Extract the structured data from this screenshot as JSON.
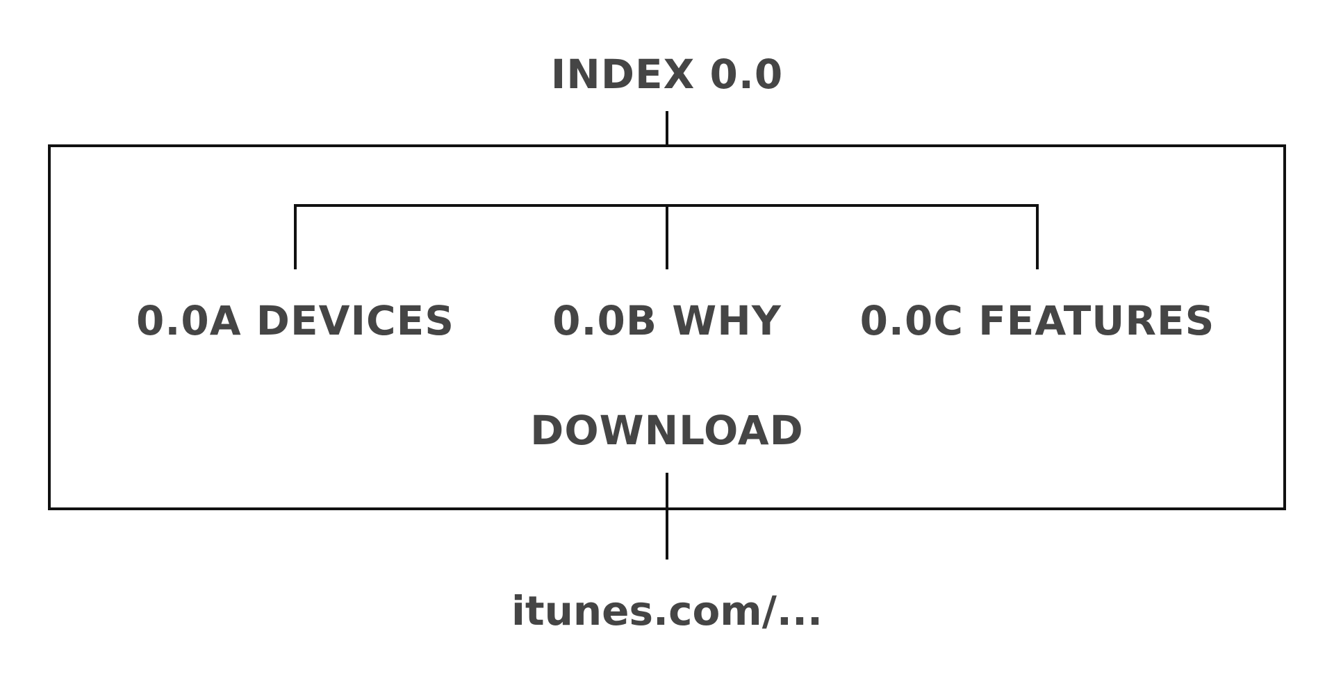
{
  "diagram": {
    "root_label": "INDEX 0.0",
    "children": [
      {
        "label": "0.0A DEVICES"
      },
      {
        "label": "0.0B WHY"
      },
      {
        "label": "0.0C FEATURES"
      }
    ],
    "download_label": "DOWNLOAD",
    "link_label": "itunes.com/..."
  },
  "colors": {
    "text": "#454545",
    "line": "#111111",
    "background": "#ffffff"
  }
}
